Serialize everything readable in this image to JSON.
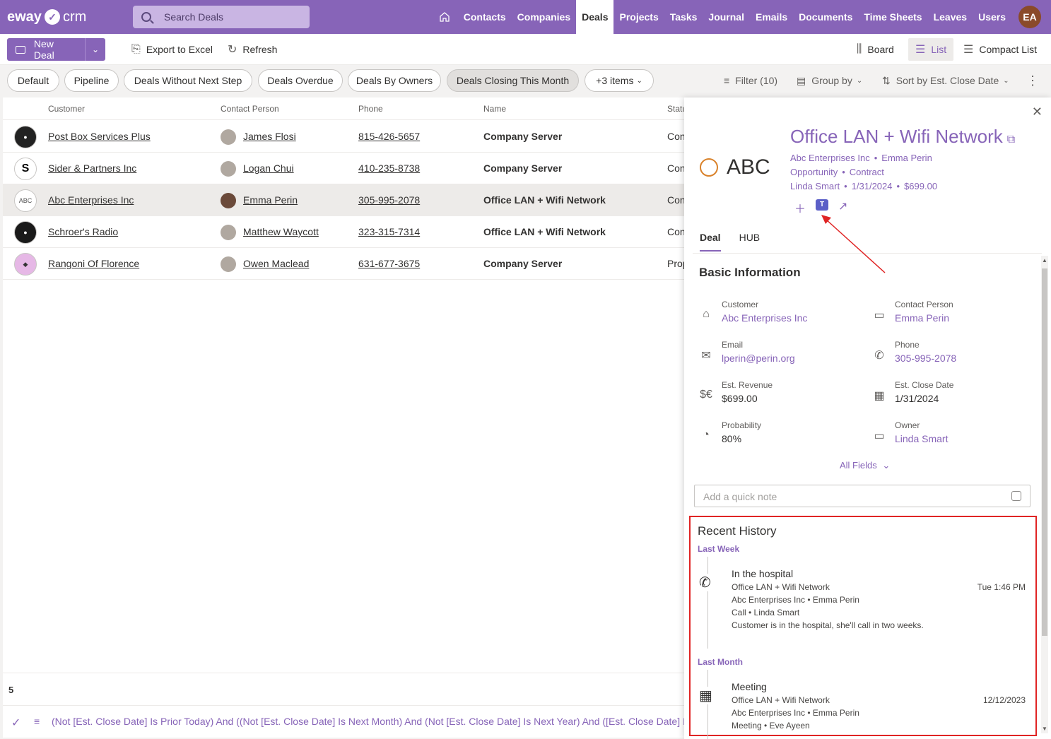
{
  "app": {
    "brand_left": "eway",
    "brand_right": "crm",
    "user_initials": "EA"
  },
  "search": {
    "placeholder": "Search Deals"
  },
  "nav": {
    "items": [
      "Contacts",
      "Companies",
      "Deals",
      "Projects",
      "Tasks",
      "Journal",
      "Emails",
      "Documents",
      "Time Sheets",
      "Leaves",
      "Users"
    ],
    "active": "Deals"
  },
  "toolbar": {
    "new_deal": "New Deal",
    "export": "Export to Excel",
    "refresh": "Refresh",
    "board": "Board",
    "list": "List",
    "compact_list": "Compact List"
  },
  "views": [
    "Default",
    "Pipeline",
    "Deals Without Next Step",
    "Deals Overdue",
    "Deals By Owners",
    "Deals Closing This Month",
    "+3 items"
  ],
  "view_selected": "Deals Closing This Month",
  "tools": {
    "filter": "Filter (10)",
    "group_by": "Group by",
    "sort": "Sort by Est. Close Date"
  },
  "grid": {
    "columns": [
      "Customer",
      "Contact Person",
      "Phone",
      "Name",
      "Status"
    ],
    "rows": [
      {
        "customer": "Post Box Services Plus",
        "contact": "James Flosi",
        "phone": "815-426-5657",
        "name": "Company Server",
        "status": "Con"
      },
      {
        "customer": "Sider & Partners Inc",
        "contact": "Logan Chui",
        "phone": "410-235-8738",
        "name": "Company Server",
        "status": "Con"
      },
      {
        "customer": "Abc Enterprises Inc",
        "contact": "Emma Perin",
        "phone": "305-995-2078",
        "name": "Office LAN + Wifi Network",
        "status": "Con"
      },
      {
        "customer": "Schroer's Radio",
        "contact": "Matthew Waycott",
        "phone": "323-315-7314",
        "name": "Office LAN + Wifi Network",
        "status": "Con"
      },
      {
        "customer": "Rangoni Of Florence",
        "contact": "Owen Maclead",
        "phone": "631-677-3675",
        "name": "Company Server",
        "status": "Prop"
      }
    ],
    "count": "5",
    "filter_text": "(Not [Est. Close Date] Is Prior Today) And ((Not [Est. Close Date] Is Next Month) And (Not [Est. Close Date] Is Next Year) And ([Est. Close Date] Is La"
  },
  "detail": {
    "logo_text": "ABC",
    "title": "Office LAN + Wifi Network",
    "company": "Abc Enterprises Inc",
    "contact": "Emma Perin",
    "type": "Opportunity",
    "stage": "Contract",
    "owner": "Linda Smart",
    "date": "1/31/2024",
    "amount": "$699.00",
    "tabs": [
      "Deal",
      "HUB"
    ],
    "section": "Basic Information",
    "fields": {
      "customer": {
        "label": "Customer",
        "value": "Abc Enterprises Inc"
      },
      "contact_person": {
        "label": "Contact Person",
        "value": "Emma Perin"
      },
      "email": {
        "label": "Email",
        "value": "lperin@perin.org"
      },
      "phone": {
        "label": "Phone",
        "value": "305-995-2078"
      },
      "revenue": {
        "label": "Est. Revenue",
        "value": "$699.00"
      },
      "close_date": {
        "label": "Est. Close Date",
        "value": "1/31/2024"
      },
      "probability": {
        "label": "Probability",
        "value": "80%"
      },
      "owner": {
        "label": "Owner",
        "value": "Linda Smart"
      }
    },
    "all_fields": "All Fields",
    "note_placeholder": "Add a quick note",
    "history": {
      "title": "Recent History",
      "groups": [
        {
          "label": "Last Week",
          "item": {
            "title": "In the hospital",
            "line1": "Office LAN + Wifi Network",
            "line2": "Abc Enterprises Inc • Emma Perin",
            "line3": "Call • Linda Smart",
            "line4": "Customer is in the hospital, she'll call in two weeks.",
            "time": "Tue 1:46 PM"
          }
        },
        {
          "label": "Last Month",
          "item": {
            "title": "Meeting",
            "line1": "Office LAN + Wifi Network",
            "line2": "Abc Enterprises Inc • Emma Perin",
            "line3": "Meeting • Eve Ayeen",
            "time": "12/12/2023"
          }
        }
      ]
    }
  },
  "colors": {
    "accent": "#8764b8",
    "annotation": "#e02424"
  }
}
